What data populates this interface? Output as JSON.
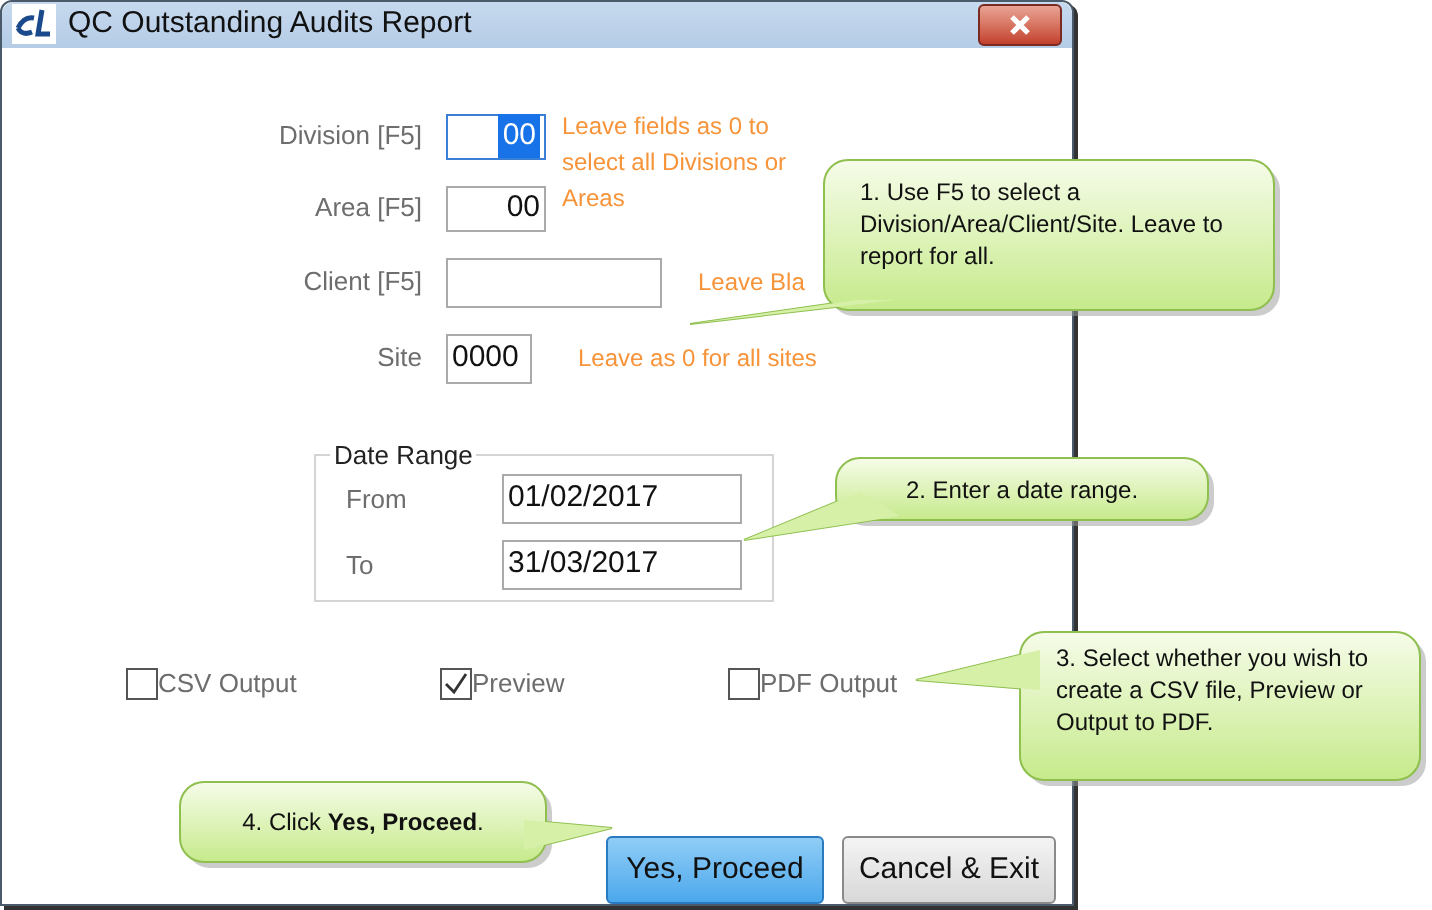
{
  "window": {
    "title": "QC Outstanding Audits Report"
  },
  "filters": [
    {
      "label": "Division [F5]",
      "value": "00",
      "kind": "code",
      "focused": true
    },
    {
      "label": "Area [F5]",
      "value": "00",
      "kind": "code",
      "focused": false
    },
    {
      "label": "Client [F5]",
      "kind": "name",
      "focused": false
    },
    {
      "label": "Site",
      "value": "0000",
      "kind": "site",
      "focused": false
    }
  ],
  "hints": [
    "Leave fields as 0 to select all Divisions or Areas",
    "Leave Bla",
    "Leave as 0 for all sites"
  ],
  "date_range": {
    "title": "Date Range",
    "from": {
      "label": "From",
      "value": "01/02/2017"
    },
    "to": {
      "label": "To",
      "value": "31/03/2017"
    }
  },
  "options": [
    {
      "label": "CSV Output",
      "checked": false
    },
    {
      "label": "Preview",
      "checked": true
    },
    {
      "label": "PDF Output",
      "checked": false
    }
  ],
  "buttons": [
    {
      "label": "Yes, Proceed",
      "selected": true
    },
    {
      "label": "Cancel & Exit",
      "selected": false
    }
  ],
  "callouts": [
    {
      "text": "1. Use F5 to select a Division/Area/Client/Site. Leave to report for all."
    },
    {
      "text": "2. Enter a date range."
    },
    {
      "text": "3. Select whether you wish to create a CSV file, Preview or Output to PDF."
    },
    {
      "text": "4. Click **Yes, Proceed**."
    }
  ]
}
